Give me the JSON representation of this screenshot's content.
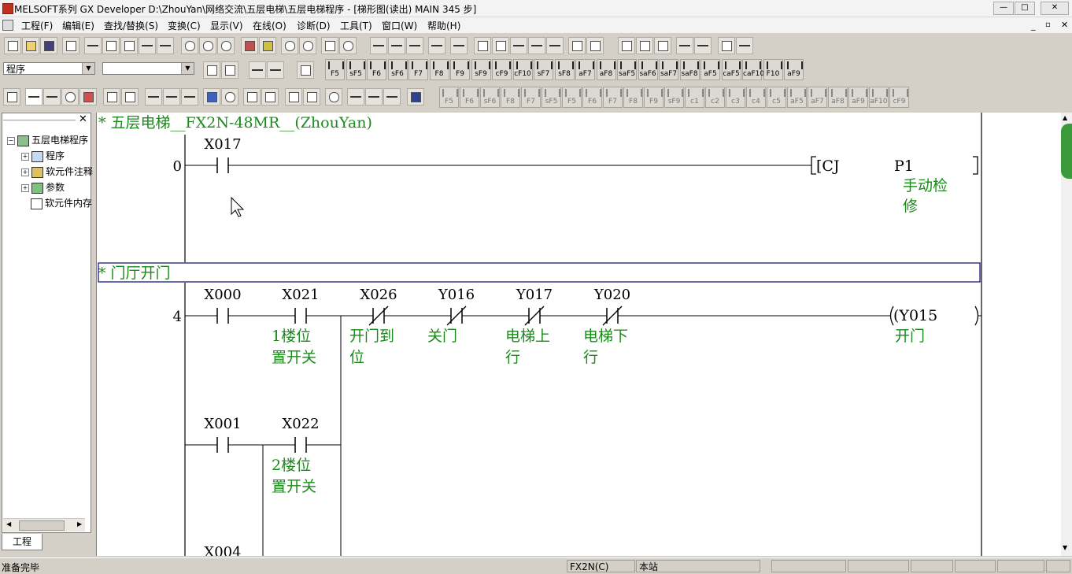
{
  "window": {
    "title": "MELSOFT系列 GX Developer D:\\ZhouYan\\网络交流\\五层电梯\\五层电梯程序 - [梯形图(读出)    MAIN    345 步]"
  },
  "menu": [
    "工程(F)",
    "编辑(E)",
    "查找/替换(S)",
    "变换(C)",
    "显示(V)",
    "在线(O)",
    "诊断(D)",
    "工具(T)",
    "窗口(W)",
    "帮助(H)"
  ],
  "toolbar": {
    "data_type_select": "程序",
    "device_select": ""
  },
  "ladder_buttons": [
    "F5",
    "sF5",
    "F6",
    "sF6",
    "F7",
    "F8",
    "F9",
    "sF9",
    "cF9",
    "cF10",
    "sF7",
    "sF8",
    "aF7",
    "aF8",
    "saF5",
    "saF6",
    "saF7",
    "saF8",
    "aF5",
    "caF5",
    "caF10",
    "F10",
    "aF9"
  ],
  "ladder_buttons_2": [
    "F5",
    "F6",
    "sF6",
    "F8",
    "F7",
    "sF5",
    "F5",
    "F6",
    "F7",
    "F8",
    "F9",
    "sF9",
    "c1",
    "c2",
    "c3",
    "c4",
    "c5",
    "aF5",
    "aF7",
    "aF8",
    "aF9",
    "aF10",
    "cF9"
  ],
  "project_tree": {
    "root": "五层电梯程序",
    "items": [
      "程序",
      "软元件注释",
      "参数",
      "软元件内存"
    ],
    "tab": "工程"
  },
  "ladder": {
    "comment1": "* 五层电梯__FX2N-48MR__(ZhouYan)",
    "step0": "0",
    "c_x017": "X017",
    "cj": "[CJ",
    "p1": "P1",
    "cj_comment_1": "手动检",
    "cj_comment_2": "修",
    "comment2": "* 门厅开门",
    "step4": "4",
    "c_x000": "X000",
    "c_x021": "X021",
    "c_x021_c1": "1楼位",
    "c_x021_c2": "置开关",
    "c_x026": "X026",
    "c_x026_c1": "开门到",
    "c_x026_c2": "位",
    "c_y016": "Y016",
    "c_y016_c1": "关门",
    "c_y017": "Y017",
    "c_y017_c1": "电梯上",
    "c_y017_c2": "行",
    "c_y020": "Y020",
    "c_y020_c1": "电梯下",
    "c_y020_c2": "行",
    "coil_y015": "(Y015",
    "coil_y015_c1": "开门",
    "c_x001": "X001",
    "c_x022": "X022",
    "c_x022_c1": "2楼位",
    "c_x022_c2": "置开关",
    "c_x004": "X004"
  },
  "status": {
    "ready": "准备完毕",
    "plc": "FX2N(C)",
    "station": "本站"
  },
  "colors": {
    "comment": "#1a8a1a",
    "cursor": "#1a1a7a",
    "background": "#d4d0c8"
  }
}
